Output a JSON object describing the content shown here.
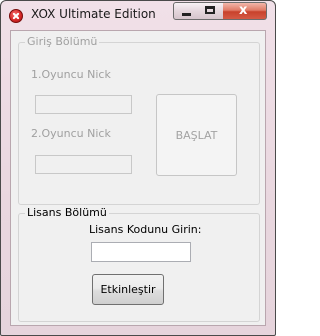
{
  "window": {
    "title": "XOX Ultimate Edition",
    "icon": "app-close-icon",
    "controls": {
      "minimize_icon": "minimize-icon",
      "maximize_icon": "maximize-icon",
      "close_glyph": "x"
    }
  },
  "giris_group": {
    "legend": "Giriş Bölümü",
    "player1_label": "1.Oyuncu Nick",
    "player1_value": "",
    "player2_label": "2.Oyuncu Nick",
    "player2_value": "",
    "start_label": "BAŞLAT"
  },
  "lisans_group": {
    "legend": "Lisans Bölümü",
    "prompt": "Lisans Kodunu Girin:",
    "code_value": "",
    "activate_label": "Etkinleştir"
  },
  "colors": {
    "titlebar": "#e9d7df",
    "client_bg": "#f0f0f0",
    "disabled_text": "#a0a0a0",
    "close_button": "#c8422c"
  }
}
